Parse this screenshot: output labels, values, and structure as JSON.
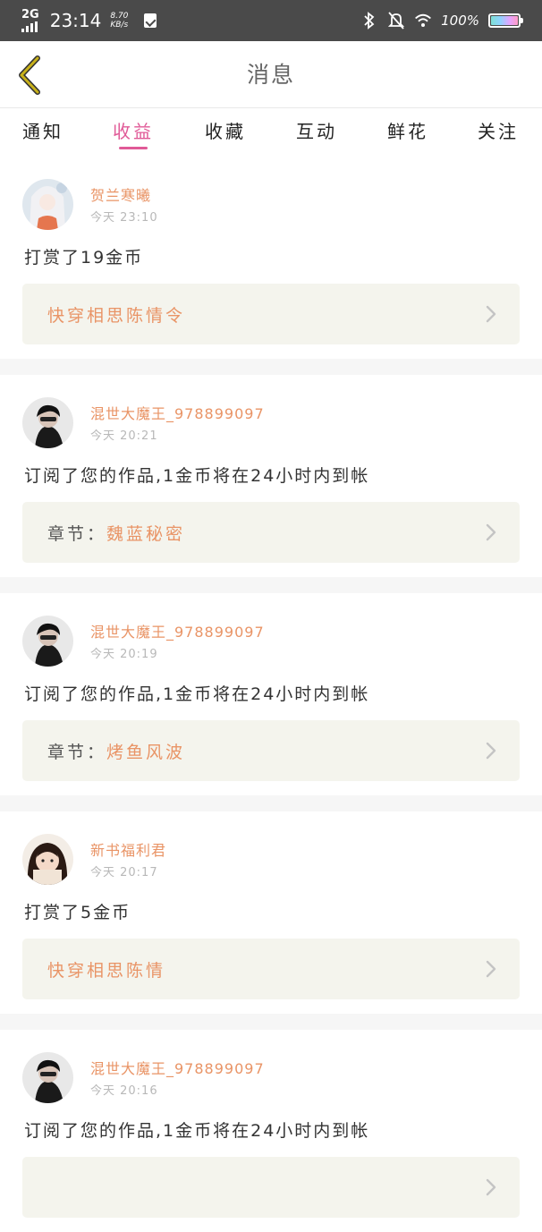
{
  "status_bar": {
    "network": "2G",
    "time": "23:14",
    "speed_value": "8.70",
    "speed_unit": "KB/s",
    "battery": "100%",
    "battery_level": 1.0,
    "icons": [
      "signal-icon",
      "clipboard-check-icon",
      "bluetooth-icon",
      "bell-off-icon",
      "wifi-icon",
      "battery-icon"
    ]
  },
  "header": {
    "title": "消息"
  },
  "tabs": [
    {
      "label": "通知",
      "active": false
    },
    {
      "label": "收益",
      "active": true
    },
    {
      "label": "收藏",
      "active": false
    },
    {
      "label": "互动",
      "active": false
    },
    {
      "label": "鲜花",
      "active": false
    },
    {
      "label": "关注",
      "active": false
    }
  ],
  "messages": [
    {
      "name": "贺兰寒曦",
      "time": "今天 23:10",
      "content": "打赏了19金币",
      "box_prefix": "",
      "box_title": "快穿相思陈情令"
    },
    {
      "name": "混世大魔王_978899097",
      "time": "今天 20:21",
      "content": "订阅了您的作品,1金币将在24小时内到帐",
      "box_prefix": "章节：",
      "box_title": "魏蓝秘密"
    },
    {
      "name": "混世大魔王_978899097",
      "time": "今天 20:19",
      "content": "订阅了您的作品,1金币将在24小时内到帐",
      "box_prefix": "章节：",
      "box_title": "烤鱼风波"
    },
    {
      "name": "新书福利君",
      "time": "今天 20:17",
      "content": "打赏了5金币",
      "box_prefix": "",
      "box_title": "快穿相思陈情"
    },
    {
      "name": "混世大魔王_978899097",
      "time": "今天 20:16",
      "content": "订阅了您的作品,1金币将在24小时内到帐",
      "box_prefix": "",
      "box_title": ""
    }
  ],
  "colors": {
    "accent": "#e05a97",
    "name": "#e99466",
    "box_bg": "#f4f4ed",
    "separator": "#f6f6f6",
    "status_bar": "#4a4a4a",
    "back_arrow": "#c8b11a"
  }
}
